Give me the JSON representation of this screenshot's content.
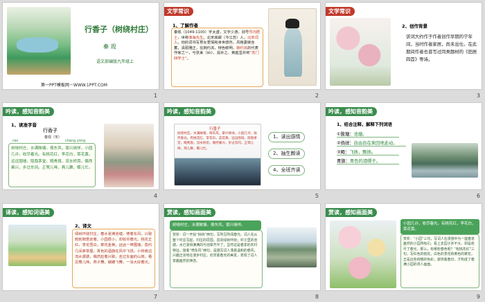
{
  "slides": [
    {
      "num": "1",
      "title": "行香子（树绕村庄）",
      "author": "秦 观",
      "edition": "语文部编版九年级上",
      "footer": "第一PPT模板网－WWW.1PPT.COM"
    },
    {
      "num": "2",
      "tag": "文学常识",
      "heading": "1、了解作者",
      "body_a": "秦观（1049-1100）字太虚，又字少游，别号",
      "body_b": "邗沟居士",
      "body_c": "，世称",
      "body_d": "淮海先生",
      "body_e": "。北宋高邮（今江苏）人，",
      "body_f": "北宋词人",
      "body_g": "。他的词书写男女爱情和身世感伤，风格委婉含蓄，清丽雅正，在婉约派，特色鲜明，",
      "body_h": "婉约派",
      "body_i": "的代表作家之一，与张耒（lěi）、晁补之、黄庭坚并称",
      "body_j": "“苏门四学士”",
      "body_k": "。"
    },
    {
      "num": "3",
      "tag": "文学常识",
      "heading": "2、创作背景",
      "body": "该词大约作于作者创作早期的宁年间，当时作者家居，尚未出仕。在此期间作者也曾写过同类题材的《田居四首》等诗。"
    },
    {
      "num": "4",
      "tag": "吟读，感知音韵美",
      "heading": "1、读准字音",
      "poem_title": "行香子",
      "poem_author": "秦观（宋）",
      "ruby_1": "ráo",
      "ruby_2": "chàng yǒng",
      "poem_body": "树绕村庄，水满陂塘。倚东风，豪兴徜徉。小园几许，收尽春光。有桃花红，李花白，菜花黄。远远围墙，隐隐茅堂。飏青旗，流水桥旁。偶然乘兴，步过东冈。正莺儿啼，燕儿舞，蝶儿忙。"
    },
    {
      "num": "5",
      "tag": "吟读，感知音韵美",
      "screen_title": "行香子",
      "screen_body": "树绕村庄，水满陂塘。倚东风，豪兴徜徉。小园几许，收尽春光。有桃花红，李花白，菜花黄。远远围墙，隐隐茅堂。飏青旗，流水桥旁。偶然乘兴，步过东冈。正莺儿啼，燕儿舞，蝶儿忙。",
      "items": [
        "1、读出感情",
        "2、抽生朗读",
        "4、全班齐读"
      ]
    },
    {
      "num": "6",
      "tag": "吟读，感知音韵美",
      "heading": "1、结合注释，解释下列词语",
      "defs": [
        {
          "term": "①陂塘：",
          "meaning": "池塘。"
        },
        {
          "term": "②徜徉：",
          "meaning": "自由自在来回地走动。"
        },
        {
          "term": "③飏：",
          "meaning": "飞扬，飘扬。"
        },
        {
          "term": "青旗：",
          "meaning": "青色的酒幌子。"
        }
      ]
    },
    {
      "num": "7",
      "tag": "译读，感知词语美",
      "heading": "2、译文",
      "body": "绿树环绕村庄，春水涨满池塘，倚着东风，兴致勃勃随意走着。小园很小，却收尽春光。桃花正红，李花雪白，菜花金黄。远远一带围墙，隐约几间茅草屋。青色的酒旗在风中飞扬，小桥旁边流水潺潺，偶然趁着兴致，走过东面的山岗，看见莺儿啼，燕子舞，蝴蝶飞舞，一派大好春光。"
    },
    {
      "num": "8",
      "tag": "赏读，感知画面美",
      "lines": "树绕村庄，水满陂塘。倚东风，豪兴徜徉。",
      "body": "赏析：词一开始“树绕”两句，写所见所闻春光。词人先从整个村庄写起，村庄的周围，层层绿树环绕；村子里的池塘，水已涨得满满的与池岸齐平了，显然这是春季的农村特征。接着“倚东风”两句，是描写词人荡着温和的春风，兴趣正浓地在漫步村庄，欣赏着春天的美景，表现了词人意趣盎然的神态。",
      "hl_1": "树绕村庄",
      "hl_2": "倚东风"
    },
    {
      "num": "9",
      "tag": "赏读，感知画面美",
      "lines": "小园几许，收尽春光。有桃花红，李花白，菜花黄。",
      "body": "赏析：“小园”三句，写词人在漫游中为一座春意盎然的小园所吸引。看上去园子并不大，却是收尽了春光。那么，有哪些春色呢？“有桃花红”三句，写红色的桃花，白色的李花和黄色的菜花，正是这些绚丽的色彩，装饰着春日，才构成了春满小园的诱人画面。"
    }
  ]
}
